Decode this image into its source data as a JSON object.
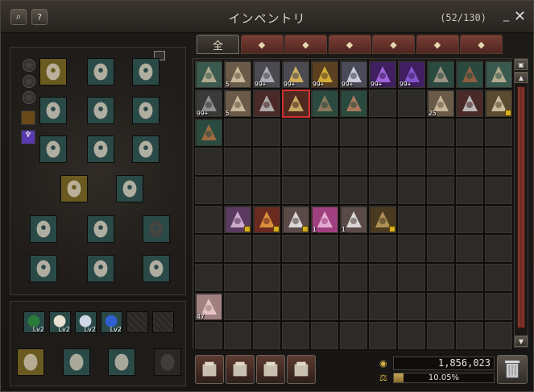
{
  "window": {
    "title": "インベントリ",
    "count": "(52/130)",
    "close": "✕",
    "minimize": "_"
  },
  "tabs": [
    {
      "label": "全",
      "icon": "all-icon"
    },
    {
      "label": "",
      "icon": "helmet-icon"
    },
    {
      "label": "",
      "icon": "potion-icon"
    },
    {
      "label": "",
      "icon": "material-icon"
    },
    {
      "label": "",
      "icon": "box-icon"
    },
    {
      "label": "",
      "icon": "quest-icon"
    },
    {
      "label": "",
      "icon": "gem-icon"
    }
  ],
  "inventory_rows": [
    [
      {
        "icon": "bow-icon"
      },
      {
        "icon": "scroll-icon",
        "qty": "5"
      },
      {
        "icon": "soulshot-icon",
        "qty": "99+"
      },
      {
        "icon": "spiritshot-icon",
        "qty": "99+"
      },
      {
        "icon": "gold-coins-icon",
        "qty": "99+"
      },
      {
        "icon": "crystal-icon",
        "qty": "99+"
      },
      {
        "icon": "purple-rune-icon",
        "qty": "99+"
      },
      {
        "icon": "purple-stone-icon",
        "qty": "99+"
      },
      {
        "icon": "gloves-icon"
      },
      {
        "icon": "boots-icon"
      },
      {
        "icon": "bow-icon"
      }
    ],
    [
      {
        "icon": "ore-icon",
        "qty": "99+"
      },
      {
        "icon": "scroll-icon",
        "qty": "5"
      },
      {
        "icon": "sword-icon"
      },
      {
        "icon": "feather-icon",
        "selected": true
      },
      {
        "icon": "leggings-icon"
      },
      {
        "icon": "belt-icon"
      },
      {},
      {},
      {
        "icon": "scroll-icon",
        "qty": "25"
      },
      {
        "icon": "claw-icon"
      },
      {
        "icon": "wings-icon",
        "locked": true
      }
    ],
    [
      {
        "icon": "jacket-icon"
      }
    ],
    [],
    [],
    [
      {},
      {
        "icon": "chest-icon",
        "locked": true
      },
      {
        "icon": "heart-gift-icon",
        "locked": true
      },
      {
        "icon": "gift-box-icon",
        "locked": true
      },
      {
        "icon": "pink-ticket-icon",
        "qty": "1"
      },
      {
        "icon": "gift-box-icon",
        "qty": "1"
      },
      {
        "icon": "cloak-icon",
        "locked": true
      }
    ],
    [],
    [],
    [
      {
        "icon": "rose-icon",
        "qty": "47"
      }
    ]
  ],
  "equip_slots": [
    {
      "icon": "earmuff-icon",
      "gold": true
    },
    {
      "icon": "necklace-icon"
    },
    {
      "icon": "earring-icon"
    },
    {
      "icon": "armor-plate-icon"
    },
    {
      "icon": "chest-armor-icon"
    },
    {
      "icon": "hands-icon"
    },
    {
      "icon": "wings-armor-icon"
    },
    {
      "icon": "pants-icon"
    },
    {
      "icon": "belt-slot-icon"
    },
    {
      "icon": "crossbow-icon",
      "gold": true
    },
    {
      "icon": "doll-icon"
    },
    {
      "icon": "ring-icon"
    },
    {
      "icon": "ring-icon"
    },
    {
      "icon": "shirt-slot-icon"
    },
    {
      "icon": "ring-icon"
    },
    {
      "icon": "ring-icon"
    },
    {
      "icon": "ring-icon"
    }
  ],
  "quick_slots": [
    {
      "icon": "green-rune-icon",
      "lv": "Lv2"
    },
    {
      "icon": "pearl-icon",
      "lv": "Lv2"
    },
    {
      "icon": "diamond-icon",
      "lv": "Lv2"
    },
    {
      "icon": "blue-gem-icon",
      "lv": "Lv2"
    },
    {},
    {}
  ],
  "bottom_slots": [
    {
      "icon": "branch-icon"
    },
    {
      "icon": "hand-orb-icon"
    },
    {
      "icon": "sun-amulet-icon"
    },
    {
      "icon": "rock-icon"
    }
  ],
  "bottom_buttons": [
    "crafting-icon",
    "gift-exchange-icon",
    "chest-open-icon",
    "scroll-action-icon"
  ],
  "adena": "1,856,023",
  "weight": {
    "percent": "10.05%",
    "value": 0.1005
  }
}
